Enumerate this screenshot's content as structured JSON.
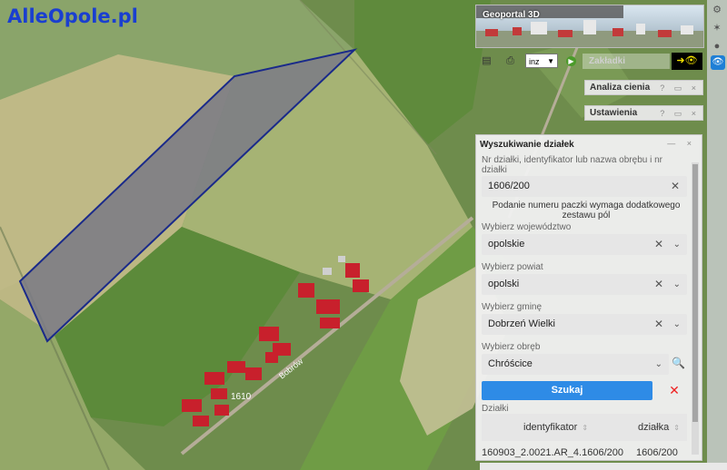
{
  "brand": "AlleOpole.pl",
  "map": {
    "road_label": "Bobrów",
    "house_number": "1610"
  },
  "geoportal3d": {
    "title": "Geoportal 3D"
  },
  "toolbar": {
    "lang_value": "inz",
    "bookmarks_label": "Zakładki"
  },
  "panels": {
    "shadow_analysis": "Analiza cienia",
    "settings": "Ustawienia",
    "help_icon": "?",
    "close_icon": "×"
  },
  "search": {
    "title": "Wyszukiwanie działek",
    "parcel_label": "Nr działki, identyfikator lub nazwa obrębu i nr działki",
    "parcel_value": "1606/200",
    "hint": "Podanie numeru paczki wymaga dodatkowego zestawu pól",
    "voivodeship_label": "Wybierz województwo",
    "voivodeship_value": "opolskie",
    "county_label": "Wybierz powiat",
    "county_value": "opolski",
    "commune_label": "Wybierz gminę",
    "commune_value": "Dobrzeń Wielki",
    "precinct_label": "Wybierz obręb",
    "precinct_value": "Chróścice",
    "search_button": "Szukaj",
    "results_label": "Działki",
    "columns": [
      "identyfikator",
      "działka"
    ],
    "rows": [
      {
        "identyfikator": "160903_2.0021.AR_4.1606/200",
        "dzialka": "1606/200"
      }
    ]
  },
  "colors": {
    "accent": "#2e8be6",
    "parcel_outline": "#1a2a8a",
    "clear": "#e22222"
  }
}
